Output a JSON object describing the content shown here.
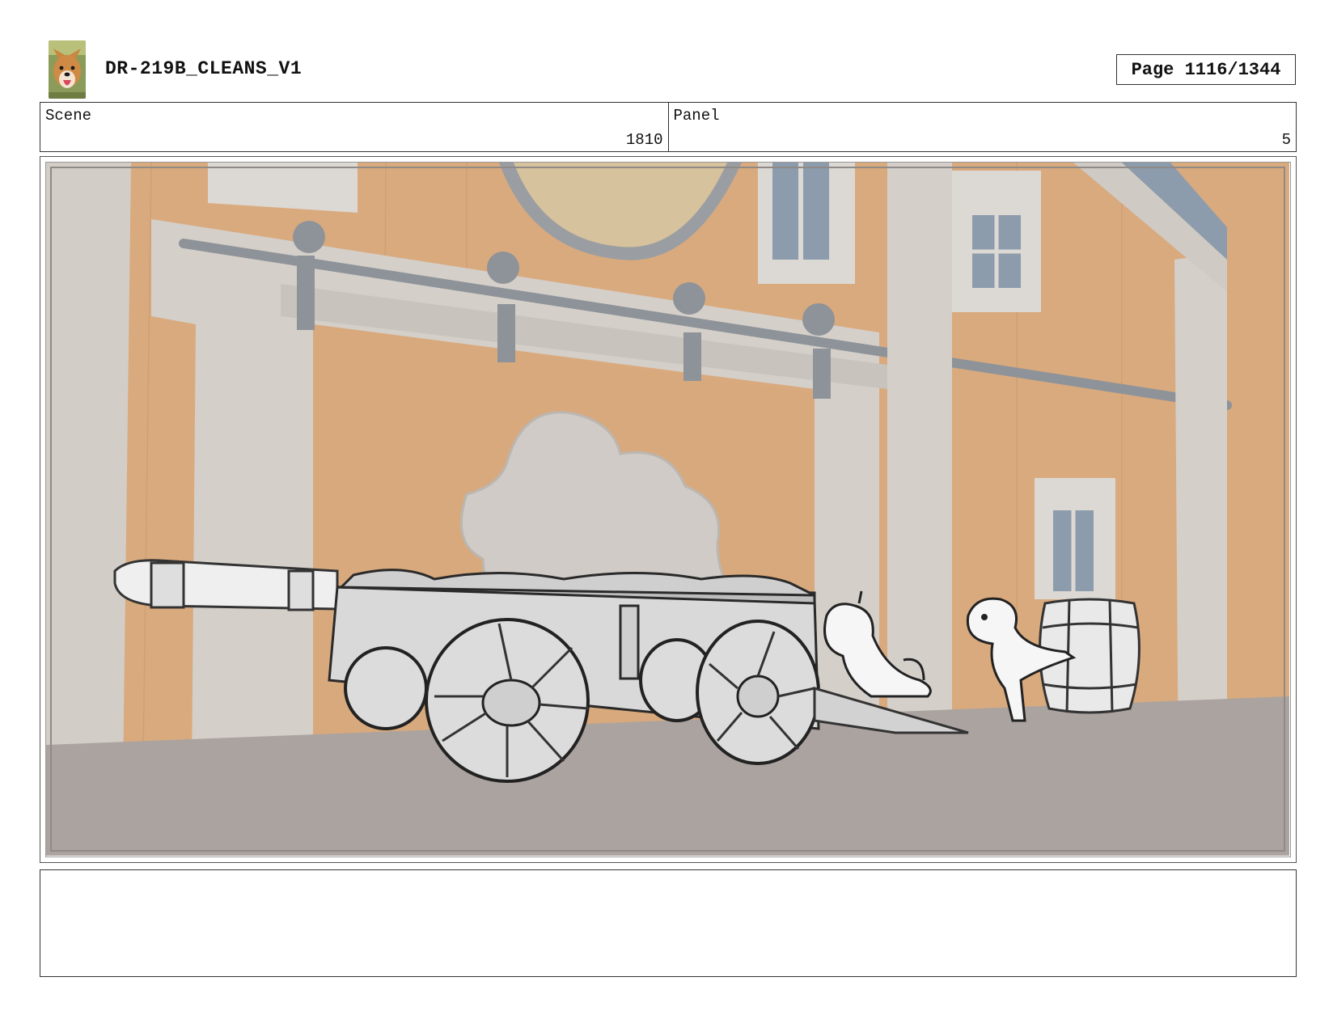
{
  "header": {
    "title": "DR-219B_CLEANS_V1",
    "page_label": "Page 1116/1344",
    "logo_icon": "dog-face-icon"
  },
  "info": {
    "scene_label": "Scene",
    "scene_value": "1810",
    "panel_label": "Panel",
    "panel_value": "5"
  },
  "panel_image": {
    "icon": "storyboard-panel-image",
    "colors": {
      "wall": "#d9aa7e",
      "trim": "#d6d2cd",
      "ground": "#aba3a0",
      "window": "#8c9cad",
      "rail": "#8e9399"
    }
  },
  "notes": {
    "text": ""
  }
}
